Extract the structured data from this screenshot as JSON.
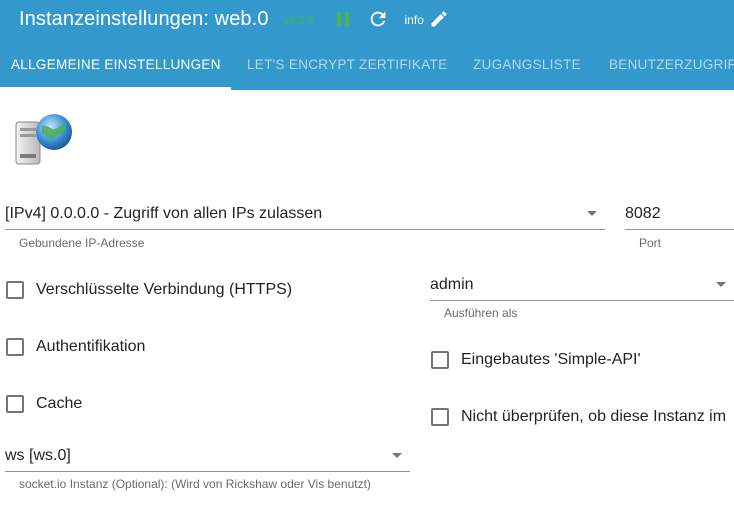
{
  "header": {
    "title": "Instanzeinstellungen: web.0",
    "version": "v6.2.5",
    "info_label": "info"
  },
  "tabs": [
    {
      "label": "Allgemeine Einstellungen"
    },
    {
      "label": "Let's Encrypt Zertifikate"
    },
    {
      "label": "Zugangsliste"
    },
    {
      "label": "Benutzerzugriff"
    }
  ],
  "form": {
    "bind_ip": {
      "value": "[IPv4] 0.0.0.0 - Zugriff von allen IPs zulassen",
      "helper": "Gebundene IP-Adresse"
    },
    "port": {
      "value": "8082",
      "helper": "Port"
    },
    "https": {
      "label": "Verschlüsselte Verbindung (HTTPS)",
      "checked": false
    },
    "run_as": {
      "value": "admin",
      "helper": "Ausführen als"
    },
    "auth": {
      "label": "Authentifikation",
      "checked": false
    },
    "simple_api": {
      "label": "Eingebautes 'Simple-API'",
      "checked": false
    },
    "cache": {
      "label": "Cache",
      "checked": false
    },
    "no_check": {
      "label": "Nicht überprüfen, ob diese Instanz im",
      "checked": false
    },
    "socketio": {
      "value": "ws [ws.0]",
      "helper": "socket.io Instanz (Optional): (Wird von Rickshaw oder Vis benutzt)"
    }
  },
  "colors": {
    "app_bar": "#3399cc",
    "version_green": "#4caf50",
    "tab_indicator": "#ffffff"
  },
  "icons": [
    "pause-icon",
    "refresh-icon",
    "edit-icon",
    "server-globe-icon",
    "dropdown-arrow-icon"
  ]
}
